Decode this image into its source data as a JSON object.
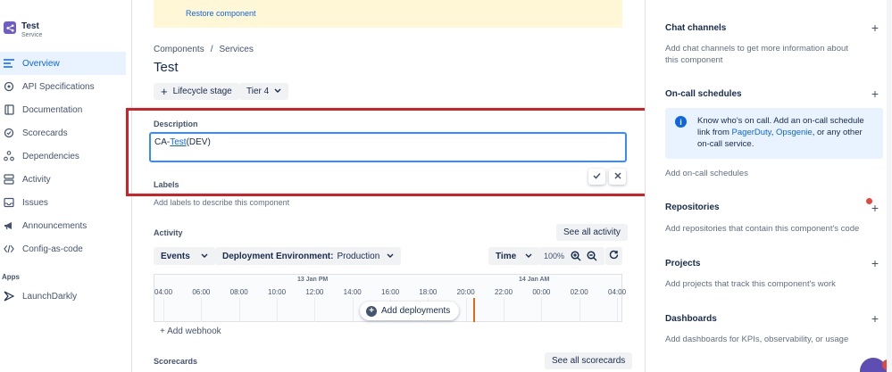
{
  "app": {
    "title": "Test",
    "subtitle": "Service"
  },
  "sidebar": {
    "items": [
      {
        "label": "Overview",
        "icon": "overview-icon"
      },
      {
        "label": "API Specifications",
        "icon": "api-icon"
      },
      {
        "label": "Documentation",
        "icon": "document-icon"
      },
      {
        "label": "Scorecards",
        "icon": "scorecard-icon"
      },
      {
        "label": "Dependencies",
        "icon": "dependency-icon"
      },
      {
        "label": "Activity",
        "icon": "activity-icon"
      },
      {
        "label": "Issues",
        "icon": "issues-icon"
      },
      {
        "label": "Announcements",
        "icon": "megaphone-icon"
      },
      {
        "label": "Config-as-code",
        "icon": "code-icon"
      }
    ],
    "apps_heading": "Apps",
    "apps": [
      {
        "label": "LaunchDarkly",
        "icon": "launchdarkly-icon"
      }
    ]
  },
  "banner": {
    "restore_link": "Restore component"
  },
  "breadcrumb": {
    "part1": "Components",
    "separator": "/",
    "part2": "Services"
  },
  "page_title": "Test",
  "buttons": {
    "lifecycle": "Lifecycle stage",
    "tier": "Tier 4"
  },
  "description": {
    "label": "Description",
    "value_prefix": "CA-",
    "value_link": "Test",
    "value_suffix": "(DEV)"
  },
  "labels": {
    "heading": "Labels",
    "placeholder": "Add labels to describe this component"
  },
  "activity": {
    "heading": "Activity",
    "see_all": "See all activity",
    "events_filter": "Events",
    "env_filter_label": "Deployment Environment:",
    "env_filter_value": "Production",
    "time_filter": "Time",
    "zoom": "100%",
    "day1": "13 Jan PM",
    "day2": "14 Jan AM",
    "hours": [
      "04:00",
      "06:00",
      "08:00",
      "10:00",
      "12:00",
      "14:00",
      "16:00",
      "18:00",
      "20:00",
      "22:00",
      "00:00",
      "02:00",
      "04:00"
    ],
    "add_deployments": "Add deployments",
    "add_webhook": "Add webhook"
  },
  "scorecards": {
    "heading": "Scorecards",
    "see_all": "See all scorecards"
  },
  "right_panel": {
    "chat_heading": "Chat channels",
    "chat_text": "Add chat channels to get more information about this component",
    "oncall_heading": "On-call schedules",
    "oncall_info_prefix": "Know who's on call. Add an on-call schedule link from ",
    "oncall_link1": "PagerDuty",
    "oncall_comma": ", ",
    "oncall_link2": "Opsgenie",
    "oncall_info_suffix": ", or any other on-call service.",
    "oncall_add": "Add on-call schedules",
    "repos_heading": "Repositories",
    "repos_text": "Add repositories that contain this component's code",
    "projects_heading": "Projects",
    "projects_text": "Add projects that track this component's work",
    "dash_heading": "Dashboards",
    "dash_text": "Add dashboards for KPIs, observability, or usage"
  },
  "colors": {
    "accent": "#0c66e4",
    "highlight": "#d32027",
    "banner": "#fff7d6"
  }
}
